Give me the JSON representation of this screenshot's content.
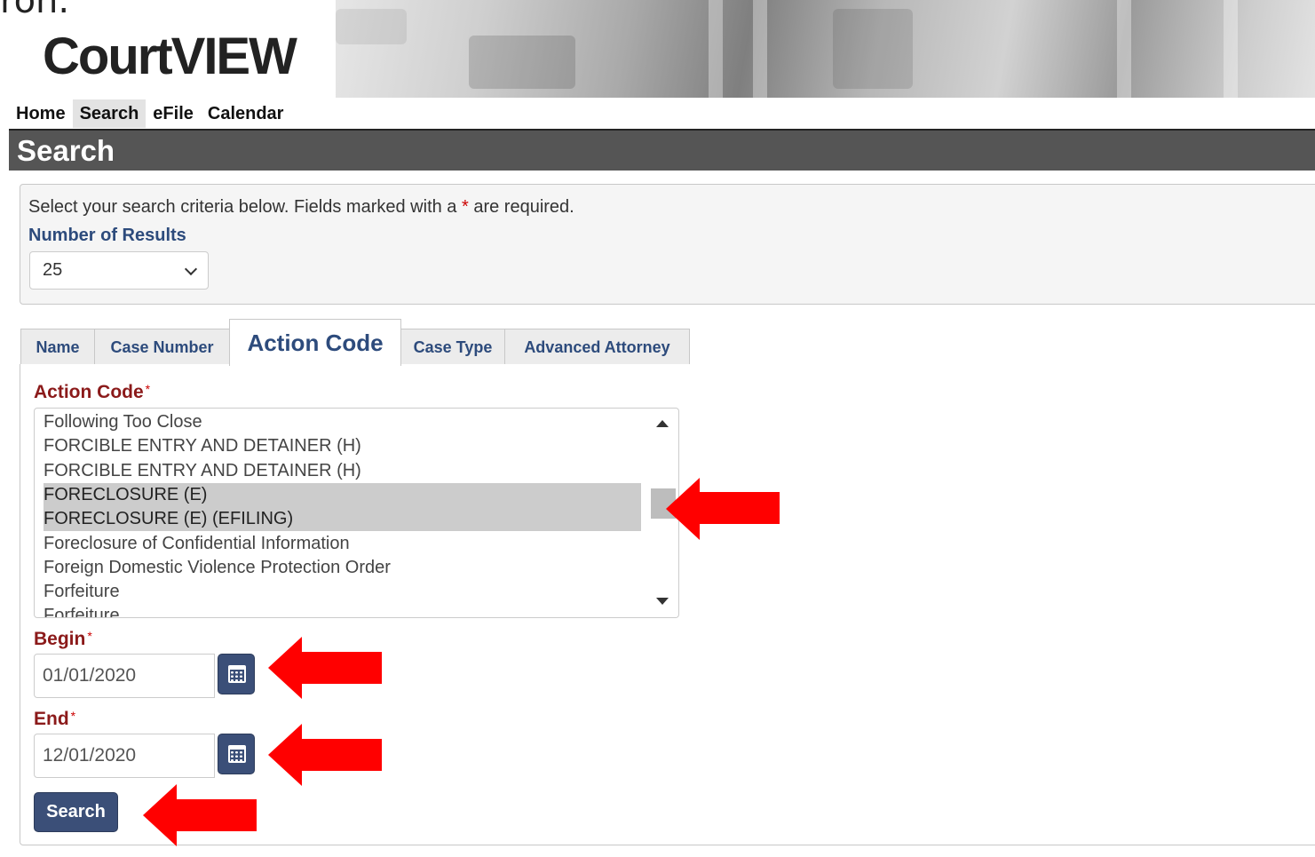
{
  "header": {
    "logo_text": "CourtVIEW",
    "cut_text": "ron."
  },
  "nav": {
    "items": [
      "Home",
      "Search",
      "eFile",
      "Calendar"
    ],
    "active": "Search"
  },
  "page_title": "Search",
  "criteria": {
    "instruction_before": "Select your search criteria below. Fields marked with a ",
    "instruction_star": "*",
    "instruction_after": " are required.",
    "number_of_results_label": "Number of Results",
    "number_of_results_value": "25"
  },
  "tabs": [
    "Name",
    "Case Number",
    "Action Code",
    "Case Type",
    "Advanced Attorney"
  ],
  "active_tab": "Action Code",
  "action_code": {
    "label": "Action Code",
    "required_mark": "*",
    "options": [
      "Following Too Close",
      "FORCIBLE ENTRY AND DETAINER (H)",
      "FORCIBLE ENTRY AND DETAINER (H)",
      "FORECLOSURE (E)",
      "FORECLOSURE (E) (EFILING)",
      "Foreclosure of Confidential Information",
      "Foreign Domestic Violence Protection Order",
      "Forfeiture",
      "Forfeiture"
    ],
    "selected": [
      "FORECLOSURE (E)",
      "FORECLOSURE (E) (EFILING)"
    ]
  },
  "begin": {
    "label": "Begin",
    "required_mark": "*",
    "value": "01/01/2020"
  },
  "end": {
    "label": "End",
    "required_mark": "*",
    "value": "12/01/2020"
  },
  "search_button": "Search",
  "colors": {
    "title_bar": "#555555",
    "label_red": "#8b1a1a",
    "label_blue": "#2d4b7c",
    "button": "#3b4f78",
    "arrow": "#ff0000"
  }
}
